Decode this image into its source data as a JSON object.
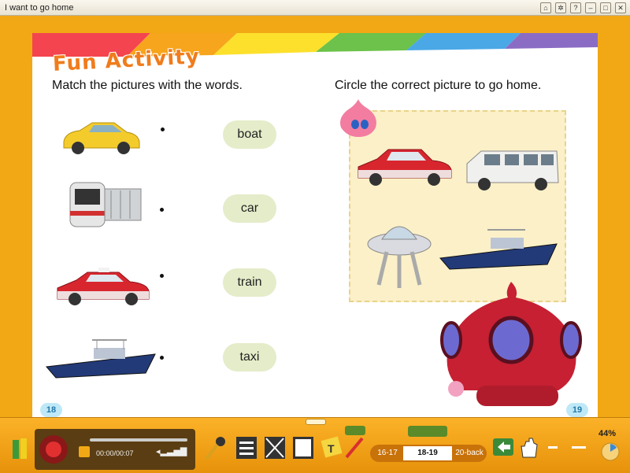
{
  "window": {
    "title": "I want to go home",
    "buttons": [
      "home",
      "settings",
      "help",
      "minimize",
      "maximize",
      "close"
    ]
  },
  "left_page": {
    "heading": "Fun Activity",
    "instruction": "Match the pictures with the words.",
    "page_number": "18",
    "pictures": [
      "yellow-car",
      "train",
      "red-taxi",
      "boat"
    ],
    "words": [
      "boat",
      "car",
      "train",
      "taxi"
    ]
  },
  "right_page": {
    "instruction": "Circle the correct picture to go home.",
    "page_number": "19",
    "options": [
      "red-taxi",
      "van",
      "flying-saucer",
      "boat"
    ]
  },
  "toolbar": {
    "time": "00:00/00:07",
    "pages_prev": "16-17",
    "pages_current": "18-19",
    "pages_next": "20-back",
    "zoom": "44%"
  },
  "colors": {
    "frame": "#f2a814",
    "heading": "#f07c1c",
    "word_bubble": "#e4ecc9",
    "panel": "#fbf0c8"
  }
}
